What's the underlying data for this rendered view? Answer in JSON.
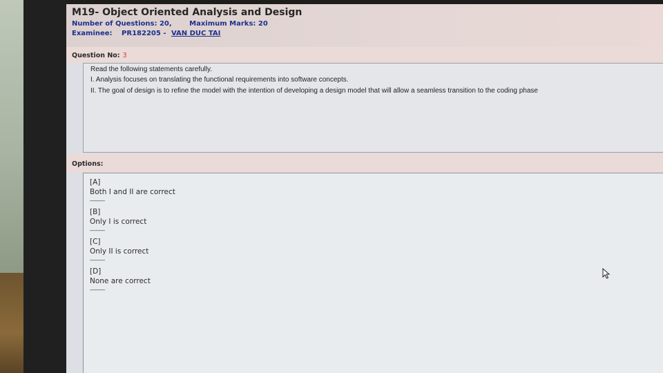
{
  "exam": {
    "course_title": "M19- Object Oriented Analysis and Design",
    "num_questions": "Number of Questions: 20,",
    "max_marks": "Maximum Marks: 20",
    "examinee_label": "Examinee:",
    "examinee_id": "PR182205",
    "examinee_sep": "-",
    "examinee_name": "VAN DUC TAI"
  },
  "question": {
    "label": "Question No:",
    "number": "3",
    "lines": [
      "Read the following statements carefully.",
      "I. Analysis focuses on translating the functional requirements into software concepts.",
      "II. The goal of design is to refine the model with the intention of developing a design model that will allow a seamless transition to the coding phase"
    ]
  },
  "options": {
    "label": "Options:",
    "separator": "----------",
    "items": [
      {
        "key": "[A]",
        "text": "Both I and II are correct"
      },
      {
        "key": "[B]",
        "text": "Only I is correct"
      },
      {
        "key": "[C]",
        "text": "Only II is correct"
      },
      {
        "key": "[D]",
        "text": "None are correct"
      }
    ]
  },
  "icons": {
    "cursor": "mouse-pointer-icon"
  }
}
